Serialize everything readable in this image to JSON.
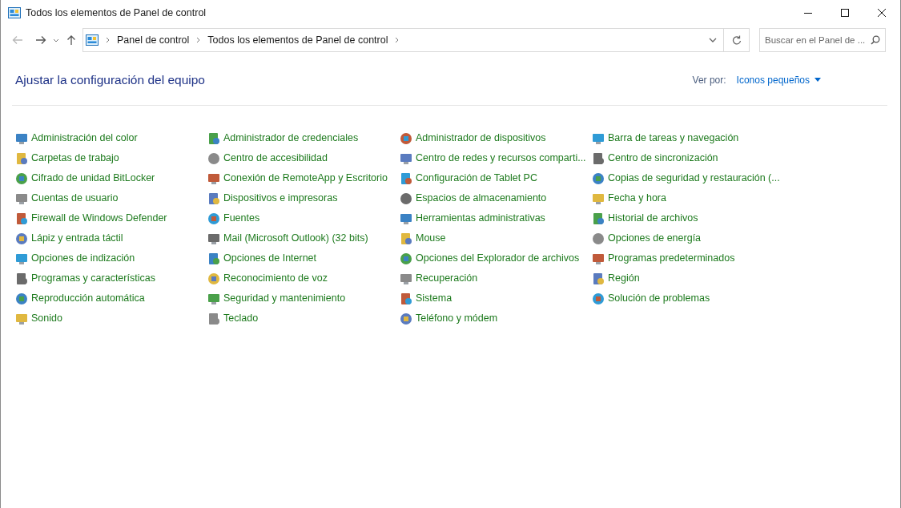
{
  "window": {
    "title": "Todos los elementos de Panel de control"
  },
  "breadcrumb": [
    "Panel de control",
    "Todos los elementos de Panel de control"
  ],
  "search": {
    "placeholder": "Buscar en el Panel de ..."
  },
  "heading": "Ajustar la configuración del equipo",
  "view_by": {
    "label": "Ver por:",
    "value": "Iconos pequeños"
  },
  "columns": [
    [
      "Administración del color",
      "Carpetas de trabajo",
      "Cifrado de unidad BitLocker",
      "Cuentas de usuario",
      "Firewall de Windows Defender",
      "Lápiz y entrada táctil",
      "Opciones de indización",
      "Programas y características",
      "Reproducción automática",
      "Sonido"
    ],
    [
      "Administrador de credenciales",
      "Centro de accesibilidad",
      "Conexión de RemoteApp y Escritorio",
      "Dispositivos e impresoras",
      "Fuentes",
      "Mail (Microsoft Outlook) (32 bits)",
      "Opciones de Internet",
      "Reconocimiento de voz",
      "Seguridad y mantenimiento",
      "Teclado"
    ],
    [
      "Administrador de dispositivos",
      "Centro de redes y recursos comparti...",
      "Configuración de Tablet PC",
      "Espacios de almacenamiento",
      "Herramientas administrativas",
      "Mouse",
      "Opciones del Explorador de archivos",
      "Recuperación",
      "Sistema",
      "Teléfono y módem"
    ],
    [
      "Barra de tareas y navegación",
      "Centro de sincronización",
      "Copias de seguridad y restauración (...",
      "Fecha y hora",
      "Historial de archivos",
      "Opciones de energía",
      "Programas predeterminados",
      "Región",
      "Solución de problemas"
    ]
  ]
}
